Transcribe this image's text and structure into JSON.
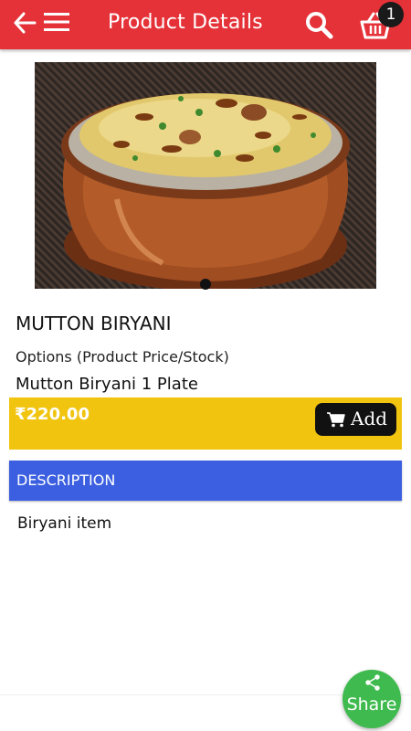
{
  "header": {
    "title": "Product Details",
    "cart_count": "1",
    "color": "#e53238"
  },
  "product": {
    "name": "MUTTON BIRYANI",
    "options_label": "Options (Product Price/Stock)",
    "variant": "Mutton Biryani 1 Plate",
    "price": "₹220.00",
    "add_label": "Add",
    "image_icon": "biryani-photo"
  },
  "description": {
    "heading": "DESCRIPTION",
    "text": "Biryani item"
  },
  "share": {
    "label": "Share"
  },
  "colors": {
    "price_bar": "#f1c40f",
    "description_bar": "#3b5fe0",
    "share_button": "#3fba4e"
  }
}
